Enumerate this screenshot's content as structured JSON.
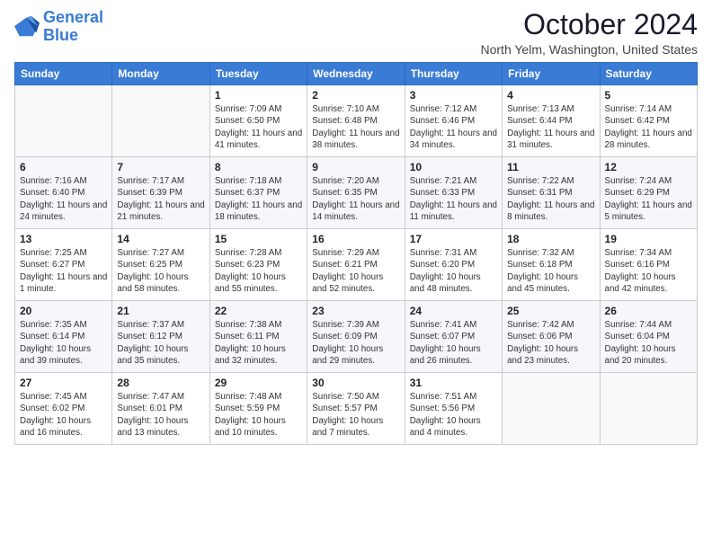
{
  "logo": {
    "line1": "General",
    "line2": "Blue"
  },
  "title": "October 2024",
  "location": "North Yelm, Washington, United States",
  "days_of_week": [
    "Sunday",
    "Monday",
    "Tuesday",
    "Wednesday",
    "Thursday",
    "Friday",
    "Saturday"
  ],
  "weeks": [
    [
      {
        "num": "",
        "info": ""
      },
      {
        "num": "",
        "info": ""
      },
      {
        "num": "1",
        "info": "Sunrise: 7:09 AM\nSunset: 6:50 PM\nDaylight: 11 hours and 41 minutes."
      },
      {
        "num": "2",
        "info": "Sunrise: 7:10 AM\nSunset: 6:48 PM\nDaylight: 11 hours and 38 minutes."
      },
      {
        "num": "3",
        "info": "Sunrise: 7:12 AM\nSunset: 6:46 PM\nDaylight: 11 hours and 34 minutes."
      },
      {
        "num": "4",
        "info": "Sunrise: 7:13 AM\nSunset: 6:44 PM\nDaylight: 11 hours and 31 minutes."
      },
      {
        "num": "5",
        "info": "Sunrise: 7:14 AM\nSunset: 6:42 PM\nDaylight: 11 hours and 28 minutes."
      }
    ],
    [
      {
        "num": "6",
        "info": "Sunrise: 7:16 AM\nSunset: 6:40 PM\nDaylight: 11 hours and 24 minutes."
      },
      {
        "num": "7",
        "info": "Sunrise: 7:17 AM\nSunset: 6:39 PM\nDaylight: 11 hours and 21 minutes."
      },
      {
        "num": "8",
        "info": "Sunrise: 7:18 AM\nSunset: 6:37 PM\nDaylight: 11 hours and 18 minutes."
      },
      {
        "num": "9",
        "info": "Sunrise: 7:20 AM\nSunset: 6:35 PM\nDaylight: 11 hours and 14 minutes."
      },
      {
        "num": "10",
        "info": "Sunrise: 7:21 AM\nSunset: 6:33 PM\nDaylight: 11 hours and 11 minutes."
      },
      {
        "num": "11",
        "info": "Sunrise: 7:22 AM\nSunset: 6:31 PM\nDaylight: 11 hours and 8 minutes."
      },
      {
        "num": "12",
        "info": "Sunrise: 7:24 AM\nSunset: 6:29 PM\nDaylight: 11 hours and 5 minutes."
      }
    ],
    [
      {
        "num": "13",
        "info": "Sunrise: 7:25 AM\nSunset: 6:27 PM\nDaylight: 11 hours and 1 minute."
      },
      {
        "num": "14",
        "info": "Sunrise: 7:27 AM\nSunset: 6:25 PM\nDaylight: 10 hours and 58 minutes."
      },
      {
        "num": "15",
        "info": "Sunrise: 7:28 AM\nSunset: 6:23 PM\nDaylight: 10 hours and 55 minutes."
      },
      {
        "num": "16",
        "info": "Sunrise: 7:29 AM\nSunset: 6:21 PM\nDaylight: 10 hours and 52 minutes."
      },
      {
        "num": "17",
        "info": "Sunrise: 7:31 AM\nSunset: 6:20 PM\nDaylight: 10 hours and 48 minutes."
      },
      {
        "num": "18",
        "info": "Sunrise: 7:32 AM\nSunset: 6:18 PM\nDaylight: 10 hours and 45 minutes."
      },
      {
        "num": "19",
        "info": "Sunrise: 7:34 AM\nSunset: 6:16 PM\nDaylight: 10 hours and 42 minutes."
      }
    ],
    [
      {
        "num": "20",
        "info": "Sunrise: 7:35 AM\nSunset: 6:14 PM\nDaylight: 10 hours and 39 minutes."
      },
      {
        "num": "21",
        "info": "Sunrise: 7:37 AM\nSunset: 6:12 PM\nDaylight: 10 hours and 35 minutes."
      },
      {
        "num": "22",
        "info": "Sunrise: 7:38 AM\nSunset: 6:11 PM\nDaylight: 10 hours and 32 minutes."
      },
      {
        "num": "23",
        "info": "Sunrise: 7:39 AM\nSunset: 6:09 PM\nDaylight: 10 hours and 29 minutes."
      },
      {
        "num": "24",
        "info": "Sunrise: 7:41 AM\nSunset: 6:07 PM\nDaylight: 10 hours and 26 minutes."
      },
      {
        "num": "25",
        "info": "Sunrise: 7:42 AM\nSunset: 6:06 PM\nDaylight: 10 hours and 23 minutes."
      },
      {
        "num": "26",
        "info": "Sunrise: 7:44 AM\nSunset: 6:04 PM\nDaylight: 10 hours and 20 minutes."
      }
    ],
    [
      {
        "num": "27",
        "info": "Sunrise: 7:45 AM\nSunset: 6:02 PM\nDaylight: 10 hours and 16 minutes."
      },
      {
        "num": "28",
        "info": "Sunrise: 7:47 AM\nSunset: 6:01 PM\nDaylight: 10 hours and 13 minutes."
      },
      {
        "num": "29",
        "info": "Sunrise: 7:48 AM\nSunset: 5:59 PM\nDaylight: 10 hours and 10 minutes."
      },
      {
        "num": "30",
        "info": "Sunrise: 7:50 AM\nSunset: 5:57 PM\nDaylight: 10 hours and 7 minutes."
      },
      {
        "num": "31",
        "info": "Sunrise: 7:51 AM\nSunset: 5:56 PM\nDaylight: 10 hours and 4 minutes."
      },
      {
        "num": "",
        "info": ""
      },
      {
        "num": "",
        "info": ""
      }
    ]
  ]
}
